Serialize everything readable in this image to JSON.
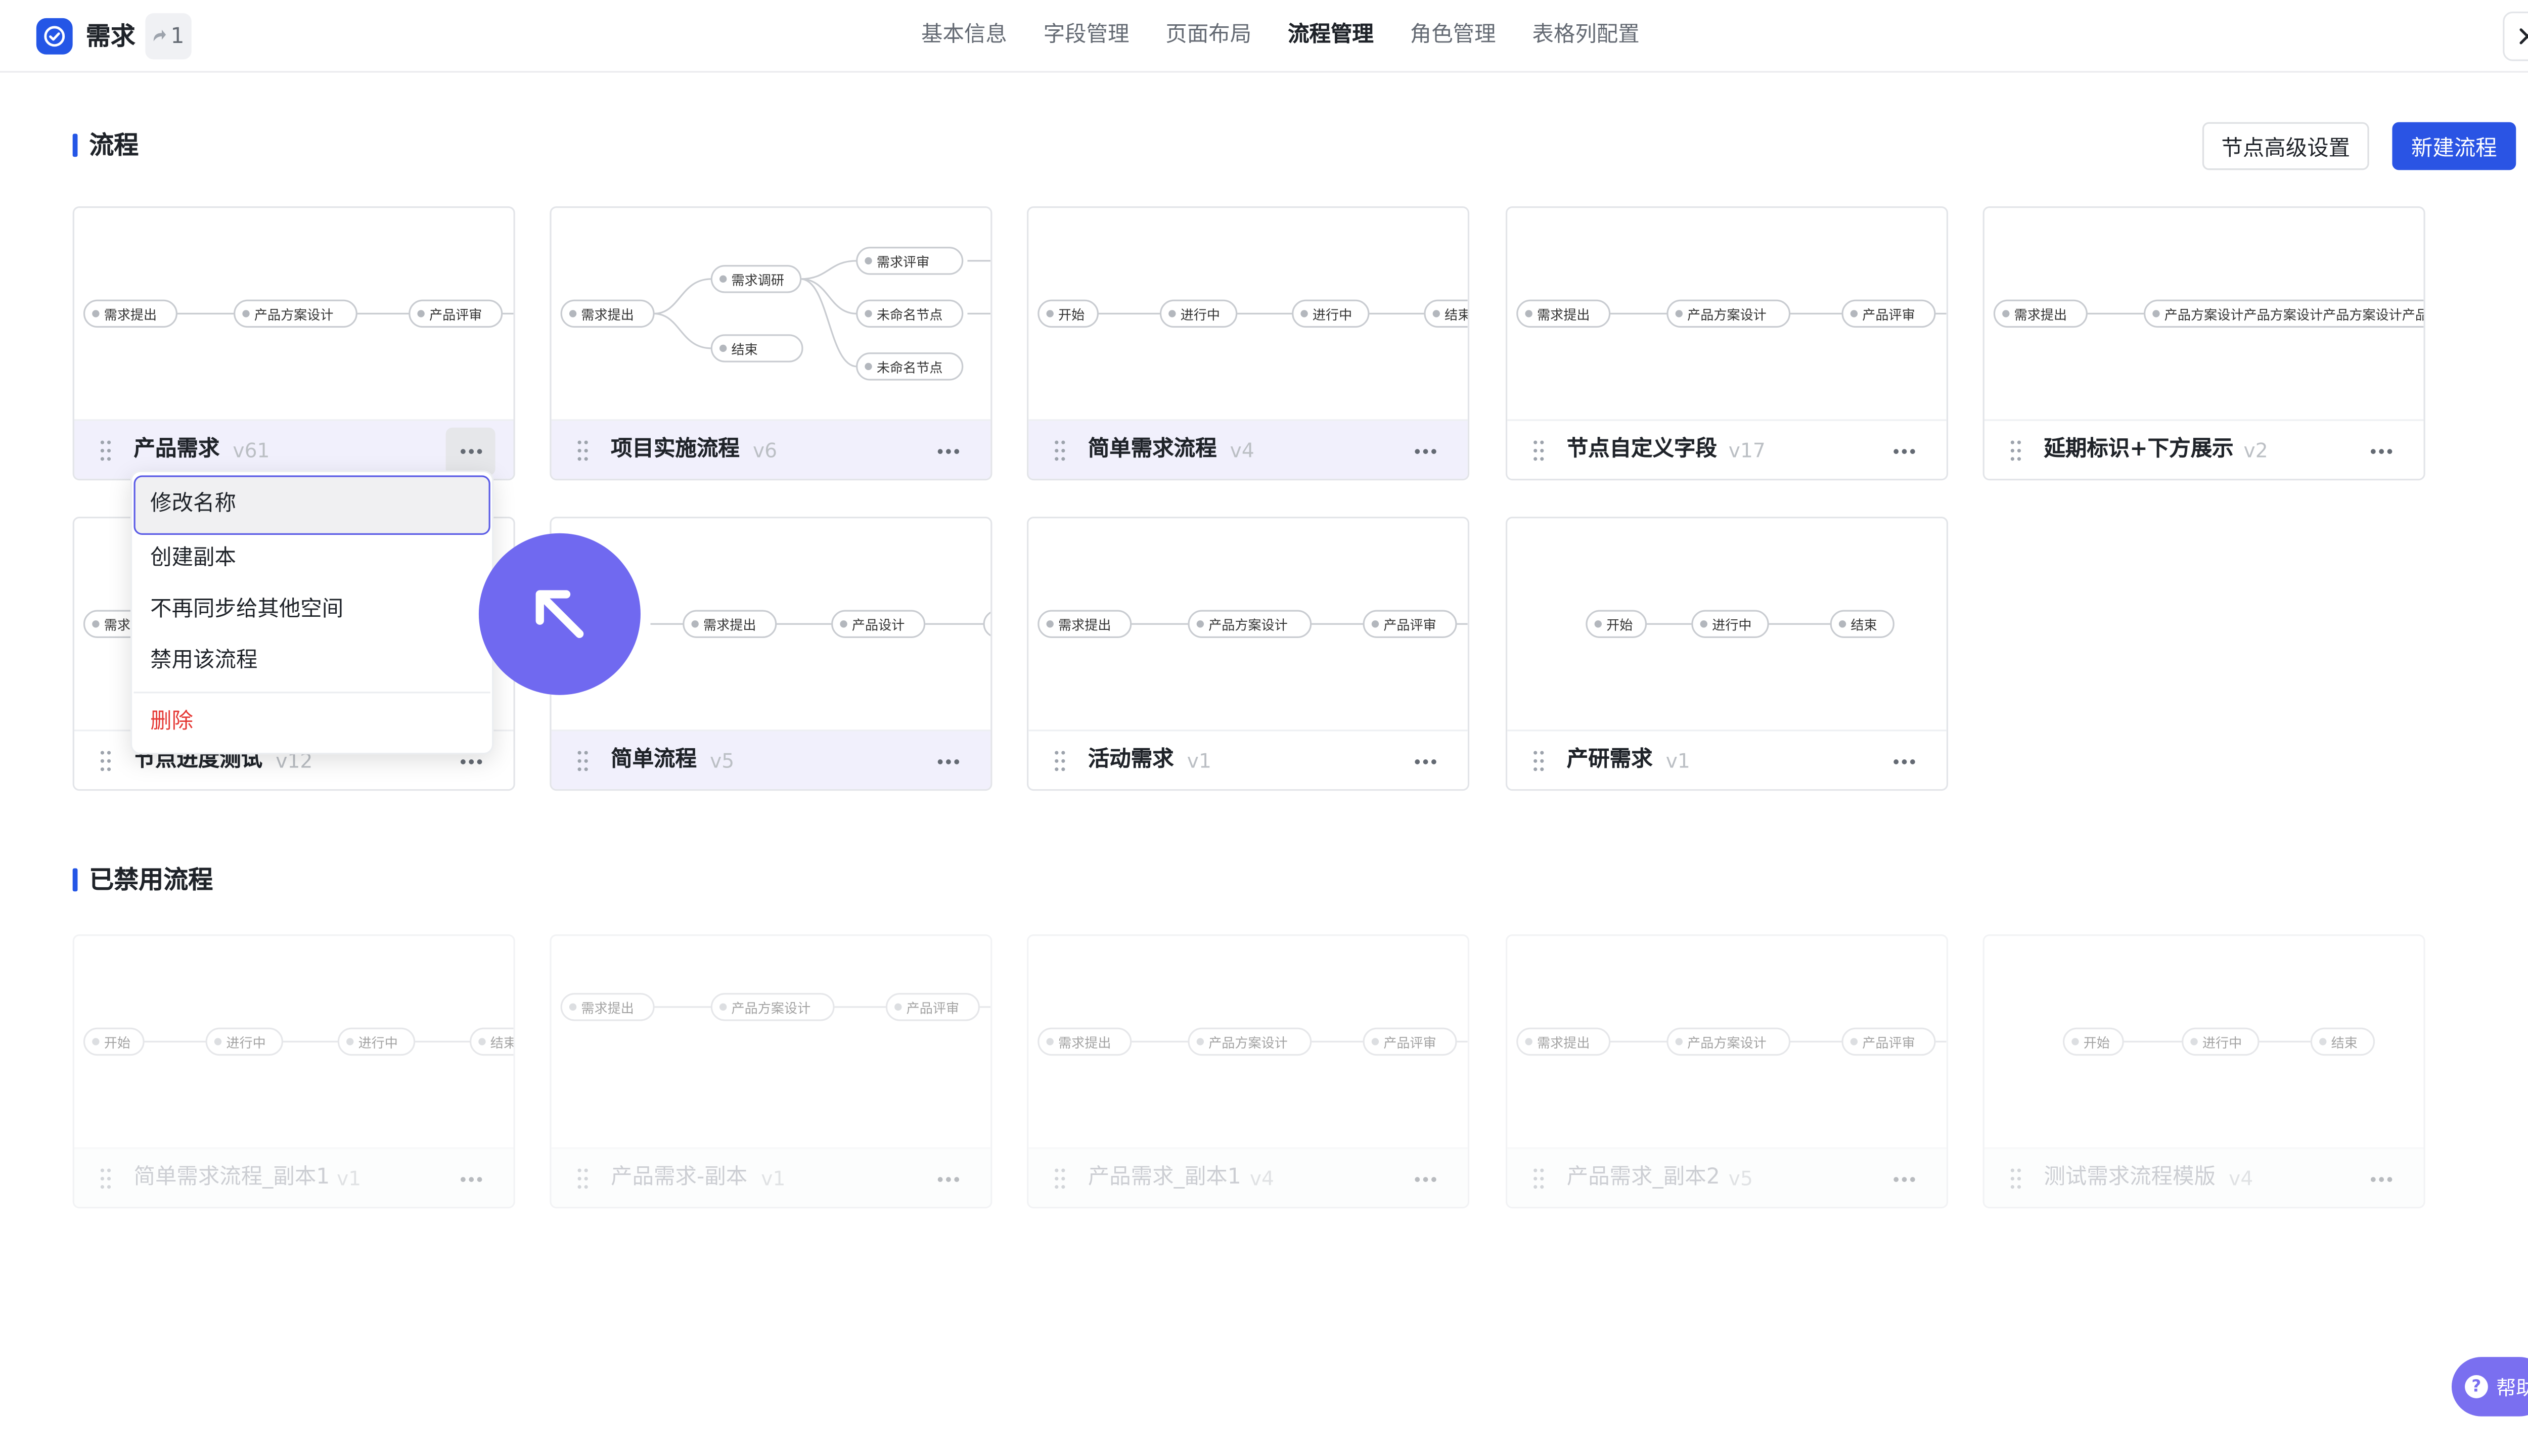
{
  "header": {
    "app_title": "需求",
    "count": "1",
    "tabs": [
      "基本信息",
      "字段管理",
      "页面布局",
      "流程管理",
      "角色管理",
      "表格列配置"
    ],
    "active_tab": "流程管理"
  },
  "flows_section": {
    "title": "流程",
    "advanced_button": "节点高级设置",
    "new_button": "新建流程"
  },
  "disabled_section": {
    "title": "已禁用流程"
  },
  "cards": [
    {
      "name": "产品需求",
      "version": "v61",
      "nodes": [
        "需求提出",
        "产品方案设计",
        "产品评审"
      ]
    },
    {
      "name": "项目实施流程",
      "version": "v6",
      "nodes": [
        "需求提出",
        "需求调研",
        "结束",
        "需求评审",
        "未命名节点",
        "未命名节点"
      ]
    },
    {
      "name": "简单需求流程",
      "version": "v4",
      "nodes": [
        "开始",
        "进行中",
        "进行中",
        "结束"
      ]
    },
    {
      "name": "节点自定义字段",
      "version": "v17",
      "nodes": [
        "需求提出",
        "产品方案设计",
        "产品评审"
      ]
    },
    {
      "name": "延期标识+下方展示",
      "version": "v2",
      "nodes": [
        "需求提出",
        "产品方案设计产品方案设计产品方案设计产品方案设计"
      ]
    },
    {
      "name": "节点进度测试",
      "version": "v12",
      "nodes": [
        "需求"
      ]
    },
    {
      "name": "简单流程",
      "version": "v5",
      "nodes": [
        "需求提出",
        "产品设计"
      ]
    },
    {
      "name": "活动需求",
      "version": "v1",
      "nodes": [
        "需求提出",
        "产品方案设计",
        "产品评审"
      ]
    },
    {
      "name": "产研需求",
      "version": "v1",
      "nodes": [
        "开始",
        "进行中",
        "结束"
      ]
    }
  ],
  "disabled_cards": [
    {
      "name": "简单需求流程_副本1",
      "version": "v1",
      "nodes": [
        "开始",
        "进行中",
        "进行中",
        "结束"
      ]
    },
    {
      "name": "产品需求-副本",
      "version": "v1",
      "nodes": [
        "需求提出",
        "产品方案设计",
        "产品评审"
      ]
    },
    {
      "name": "产品需求_副本1",
      "version": "v4",
      "nodes": [
        "需求提出",
        "产品方案设计",
        "产品评审"
      ]
    },
    {
      "name": "产品需求_副本2",
      "version": "v5",
      "nodes": [
        "需求提出",
        "产品方案设计",
        "产品评审"
      ]
    },
    {
      "name": "测试需求流程模版",
      "version": "v4",
      "nodes": [
        "开始",
        "进行中",
        "结束"
      ]
    }
  ],
  "context_menu": {
    "items": [
      "修改名称",
      "创建副本",
      "不再同步给其他空间",
      "禁用该流程"
    ],
    "danger_item": "删除",
    "selected": "修改名称"
  },
  "help": {
    "label": "帮助"
  },
  "colors": {
    "accent": "#2456e6",
    "highlight": "#f1f0fc",
    "cursor": "#7069f0",
    "danger": "#e53935"
  }
}
